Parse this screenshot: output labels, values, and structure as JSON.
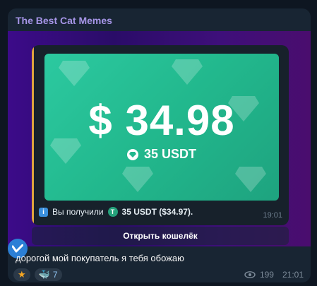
{
  "channel": {
    "name": "The Best Cat Memes"
  },
  "card": {
    "amount": "$ 34.98",
    "amount_sub": "35 USDT",
    "notice_prefix": "Вы получили",
    "notice_amount": "35 USDT ($34.97).",
    "time": "19:01",
    "button_label": "Открыть кошелёк"
  },
  "message": {
    "caption": "дорогой мой покупатель я тебя обожаю",
    "reactions": [
      {
        "icon": "star-icon",
        "count": ""
      },
      {
        "icon": "whale-icon",
        "count": "7"
      }
    ],
    "views": "199",
    "time": "21:01"
  },
  "colors": {
    "accent": "#a695e7",
    "card_green": "#22b88d",
    "background": "#0e1621"
  }
}
